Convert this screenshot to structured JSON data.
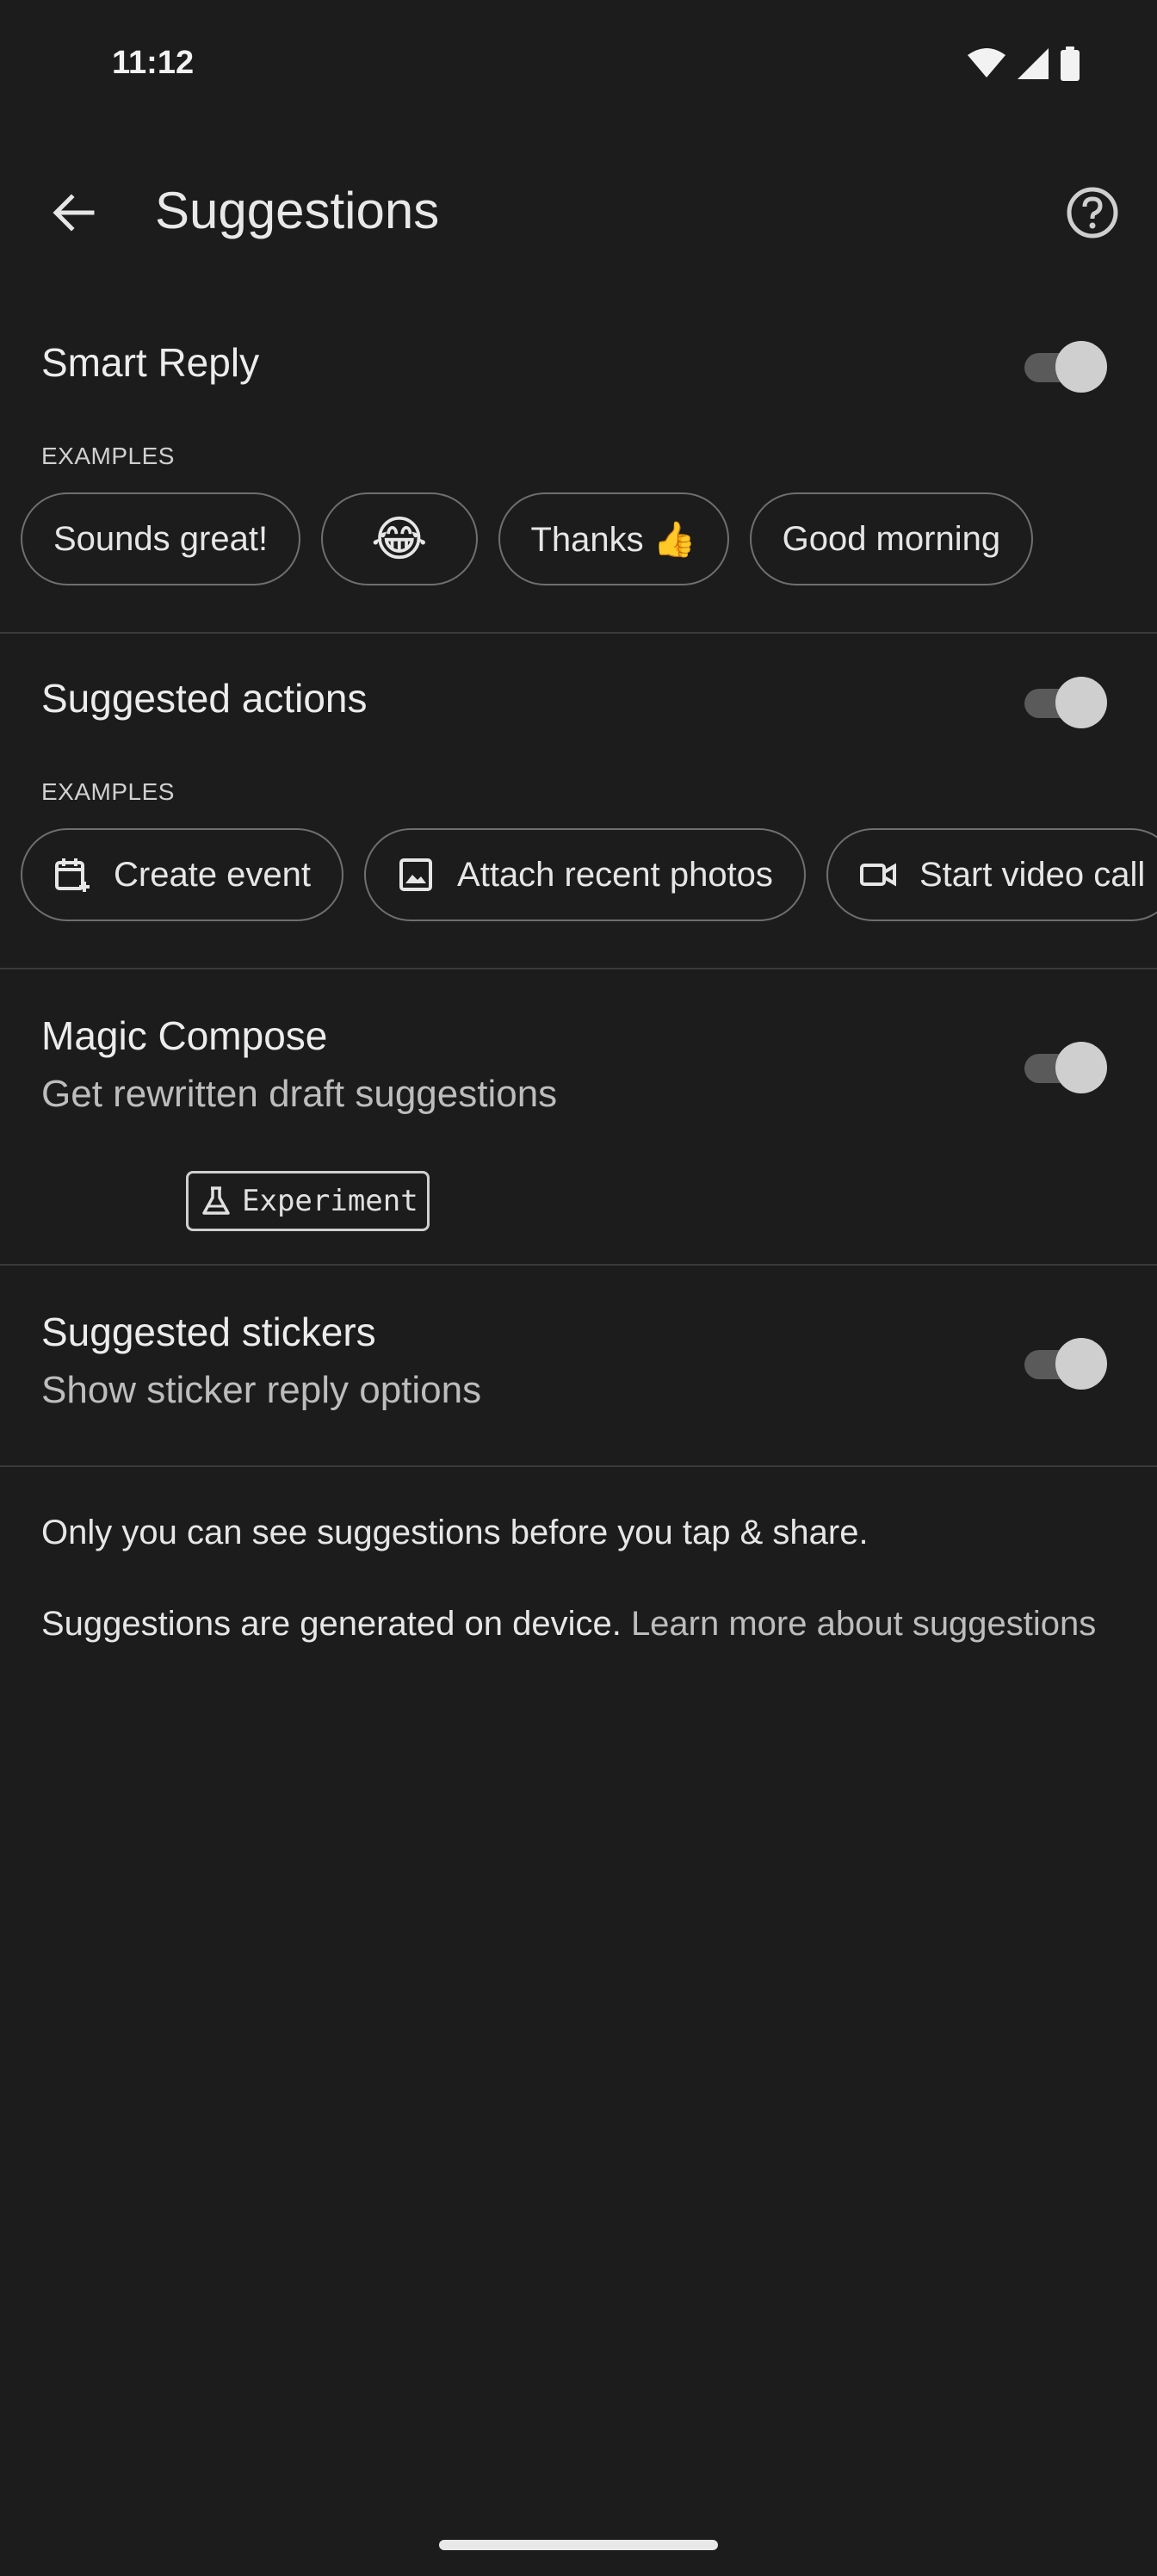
{
  "status_bar": {
    "time": "11:12",
    "icons": [
      "wifi-icon",
      "signal-icon",
      "battery-icon"
    ]
  },
  "header": {
    "title": "Suggestions",
    "back_icon": "arrow-back-icon",
    "help_icon": "help-circle-icon"
  },
  "smart_reply": {
    "title": "Smart Reply",
    "enabled": true,
    "examples_label": "EXAMPLES",
    "chips": [
      "Sounds great!",
      "😂",
      "Thanks 👍",
      "Good morning"
    ]
  },
  "suggested_actions": {
    "title": "Suggested actions",
    "enabled": true,
    "examples_label": "EXAMPLES",
    "chips": [
      {
        "icon": "calendar-add-icon",
        "label": "Create event"
      },
      {
        "icon": "image-icon",
        "label": "Attach recent photos"
      },
      {
        "icon": "videocam-icon",
        "label": "Start video call"
      }
    ]
  },
  "magic_compose": {
    "title": "Magic Compose",
    "subtitle": "Get rewritten draft suggestions",
    "enabled": true,
    "badge": "Experiment"
  },
  "suggested_stickers": {
    "title": "Suggested stickers",
    "subtitle": "Show sticker reply options",
    "enabled": true
  },
  "footer": {
    "privacy_note": "Only you can see suggestions before you tap & share.",
    "device_note": "Suggestions are generated on device.",
    "learn_more": "Learn more about suggestions"
  },
  "colors": {
    "background": "#1c1c1c",
    "toggle_track": "#5a5a5a",
    "toggle_thumb": "#cfcfcf",
    "chip_border": "#6f6f6f"
  }
}
